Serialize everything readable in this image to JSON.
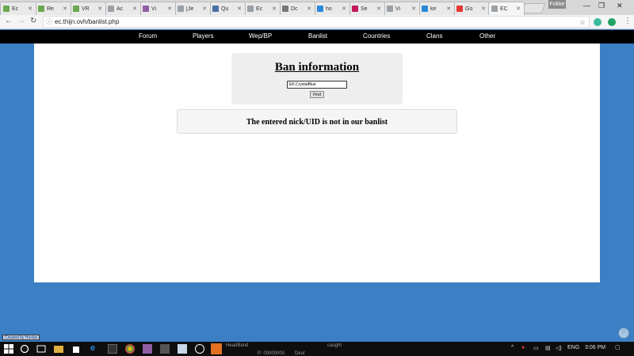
{
  "browser": {
    "tabs": [
      {
        "label": "Ec",
        "color": "#6aa84f"
      },
      {
        "label": "Re",
        "color": "#6aa84f"
      },
      {
        "label": "VR",
        "color": "#6aa84f"
      },
      {
        "label": "Ac",
        "color": "#9aa0a6"
      },
      {
        "label": "Vi",
        "color": "#8e5ea2"
      },
      {
        "label": "[Je",
        "color": "#9aa0a6"
      },
      {
        "label": "Qu",
        "color": "#4a6fa5"
      },
      {
        "label": "Ec",
        "color": "#9aa0a6"
      },
      {
        "label": "Dc",
        "color": "#777777"
      },
      {
        "label": "ho",
        "color": "#2b88d8"
      },
      {
        "label": "Se",
        "color": "#c2185b"
      },
      {
        "label": "Vi",
        "color": "#9aa0a6"
      },
      {
        "label": "ke",
        "color": "#2b88d8"
      },
      {
        "label": "Go",
        "color": "#e53935"
      },
      {
        "label": "EC",
        "color": "#9aa0a6",
        "active": true
      }
    ],
    "profile": "Fokke",
    "url": "ec.thijn.ovh/banlist.php"
  },
  "site_nav": {
    "items": [
      "Forum",
      "Players",
      "Wep/BP",
      "Banlist",
      "Countries",
      "Clans",
      "Other"
    ]
  },
  "ban_search": {
    "title": "Ban information",
    "input_value": "EK.CrystalBlue",
    "button_label": "Find"
  },
  "result": {
    "message": "The entered nick/UID is not in our banlist"
  },
  "footer": {
    "credit": "Created by Hoxtas"
  },
  "taskbar": {
    "background_text_1": "HeadBand",
    "background_text_2": "P: 00000000",
    "background_text_3": "Deut",
    "background_text_4": "caught",
    "tray_language": "ENG",
    "clock": "3:06 PM"
  }
}
